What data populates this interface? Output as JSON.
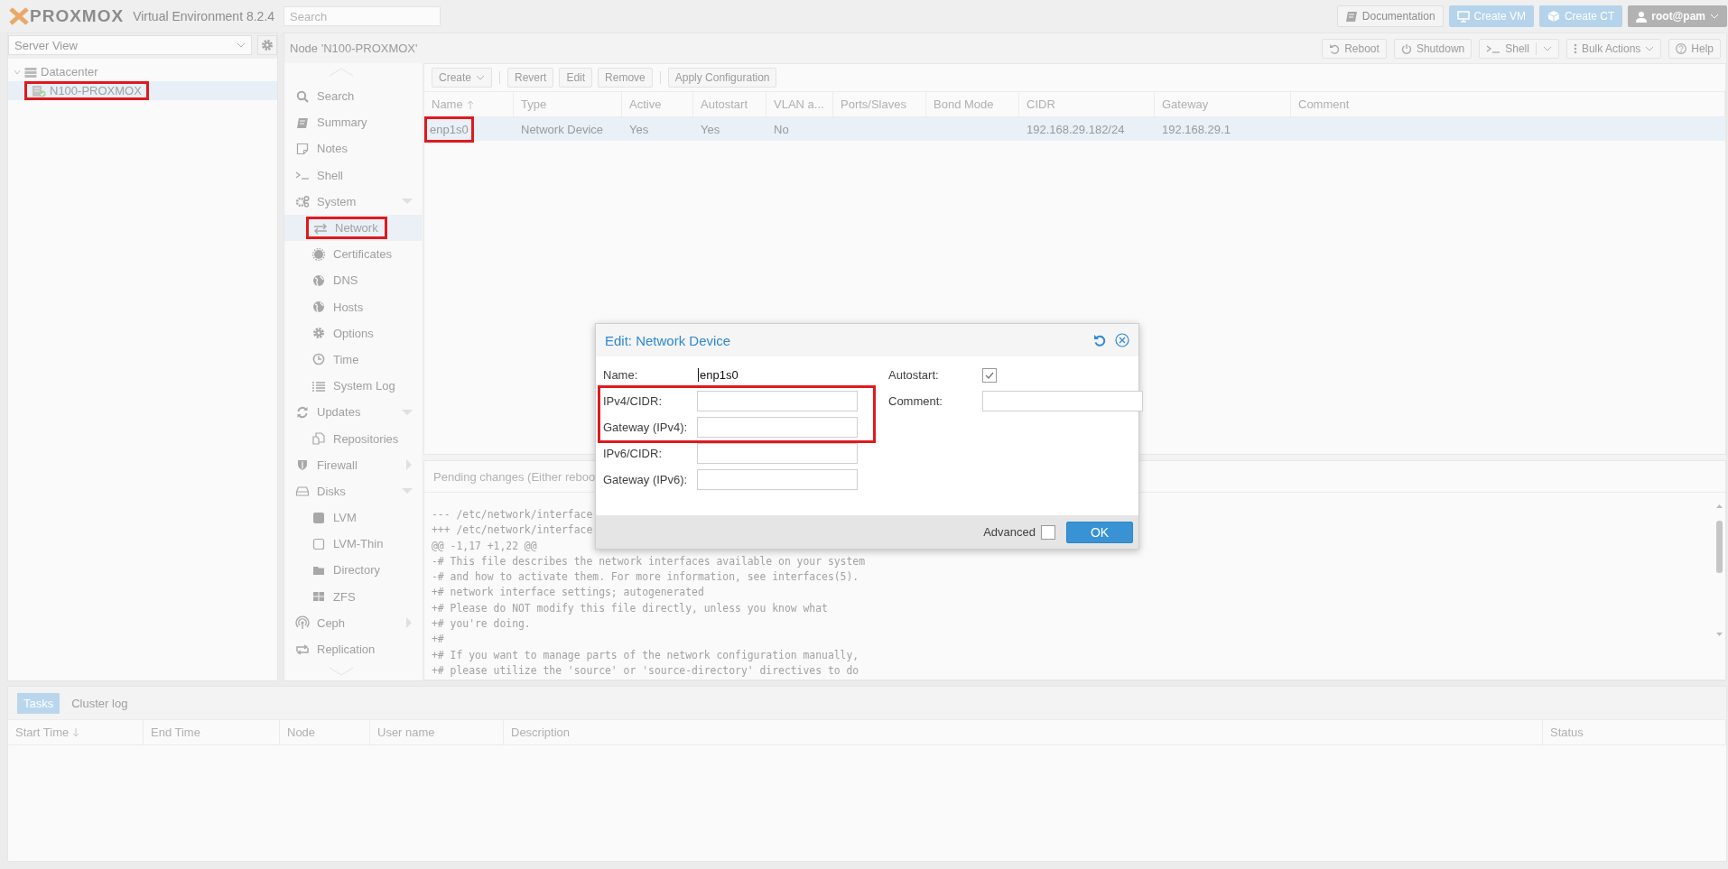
{
  "header": {
    "logo": "PROXMOX",
    "product": "Virtual Environment 8.2.4",
    "search": {
      "placeholder": "Search"
    },
    "buttons": [
      {
        "label": "Documentation",
        "kind": "plain"
      },
      {
        "label": "Create VM",
        "kind": "primary"
      },
      {
        "label": "Create CT",
        "kind": "primary"
      },
      {
        "label": "root@pam",
        "kind": "user"
      }
    ]
  },
  "resource_tree": {
    "view": "Server View",
    "items": [
      {
        "label": "Datacenter",
        "expanded": true,
        "selected": false,
        "highlighted": false,
        "children": [
          {
            "label": "N100-PROXMOX",
            "selected": true,
            "highlighted": true
          }
        ]
      }
    ]
  },
  "node_panel": {
    "title": "Node 'N100-PROXMOX'",
    "buttons": [
      {
        "label": "Reboot",
        "kind": "plain"
      },
      {
        "label": "Shutdown",
        "kind": "plain"
      },
      {
        "label": "Shell",
        "kind": "split"
      },
      {
        "label": "Bulk Actions",
        "kind": "menu"
      },
      {
        "label": "Help",
        "kind": "plain"
      }
    ]
  },
  "nav": [
    {
      "label": "Search",
      "kind": "item",
      "selected": false,
      "highlighted": false
    },
    {
      "label": "Summary",
      "kind": "item",
      "selected": false,
      "highlighted": false
    },
    {
      "label": "Notes",
      "kind": "item",
      "selected": false,
      "highlighted": false
    },
    {
      "label": "Shell",
      "kind": "item",
      "selected": false,
      "highlighted": false
    },
    {
      "label": "System",
      "kind": "group",
      "expanded": true,
      "selected": false,
      "highlighted": false,
      "children": [
        {
          "label": "Network",
          "selected": true,
          "highlighted": true
        },
        {
          "label": "Certificates",
          "selected": false,
          "highlighted": false
        },
        {
          "label": "DNS",
          "selected": false,
          "highlighted": false
        },
        {
          "label": "Hosts",
          "selected": false,
          "highlighted": false
        },
        {
          "label": "Options",
          "selected": false,
          "highlighted": false
        },
        {
          "label": "Time",
          "selected": false,
          "highlighted": false
        },
        {
          "label": "System Log",
          "selected": false,
          "highlighted": false
        }
      ]
    },
    {
      "label": "Updates",
      "kind": "group",
      "expanded": true,
      "selected": false,
      "highlighted": false,
      "children": [
        {
          "label": "Repositories",
          "selected": false,
          "highlighted": false
        }
      ]
    },
    {
      "label": "Firewall",
      "kind": "group",
      "expanded": false,
      "selected": false,
      "highlighted": false
    },
    {
      "label": "Disks",
      "kind": "group",
      "expanded": true,
      "selected": false,
      "highlighted": false,
      "children": [
        {
          "label": "LVM",
          "selected": false,
          "highlighted": false
        },
        {
          "label": "LVM-Thin",
          "selected": false,
          "highlighted": false
        },
        {
          "label": "Directory",
          "selected": false,
          "highlighted": false
        },
        {
          "label": "ZFS",
          "selected": false,
          "highlighted": false
        }
      ]
    },
    {
      "label": "Ceph",
      "kind": "group",
      "expanded": false,
      "selected": false,
      "highlighted": false
    },
    {
      "label": "Replication",
      "kind": "item",
      "selected": false,
      "highlighted": false
    }
  ],
  "network": {
    "toolbar": [
      {
        "label": "Create",
        "kind": "menu"
      },
      {
        "label": "Revert",
        "kind": "plain"
      },
      {
        "label": "Edit",
        "kind": "plain"
      },
      {
        "label": "Remove",
        "kind": "plain"
      },
      {
        "label": "Apply Configuration",
        "kind": "plain"
      }
    ],
    "columns": [
      {
        "label": "Name",
        "sorted": true,
        "descending": false
      },
      {
        "label": "Type",
        "sorted": false
      },
      {
        "label": "Active",
        "sorted": false
      },
      {
        "label": "Autostart",
        "sorted": false
      },
      {
        "label": "VLAN a...",
        "sorted": false
      },
      {
        "label": "Ports/Slaves",
        "sorted": false
      },
      {
        "label": "Bond Mode",
        "sorted": false
      },
      {
        "label": "CIDR",
        "sorted": false
      },
      {
        "label": "Gateway",
        "sorted": false
      },
      {
        "label": "Comment",
        "sorted": false
      }
    ],
    "rows": [
      {
        "selected": true,
        "cells": [
          {
            "text": "enp1s0",
            "highlighted": true
          },
          {
            "text": "Network Device"
          },
          {
            "text": "Yes"
          },
          {
            "text": "Yes"
          },
          {
            "text": "No"
          },
          null,
          null,
          {
            "text": "192.168.29.182/24"
          },
          {
            "text": "192.168.29.1"
          },
          null
        ]
      }
    ],
    "pending": {
      "title": "Pending changes (Either reboo",
      "lines": [
        "--- /etc/network/interface",
        "+++ /etc/network/interface",
        "@@ -1,17 +1,22 @@",
        "-# This file describes the network interfaces available on your system",
        "-# and how to activate them. For more information, see interfaces(5).",
        "+# network interface settings; autogenerated",
        "+# Please do NOT modify this file directly, unless you know what",
        "+# you're doing.",
        "+#",
        "+# If you want to manage parts of the network configuration manually,",
        "+# please utilize the 'source' or 'source-directory' directives to do"
      ]
    }
  },
  "dialog": {
    "title": "Edit: Network Device",
    "left_fields": [
      {
        "label": "Name:",
        "kind": "display",
        "value": "enp1s0",
        "highlighted": false
      },
      {
        "label": "IPv4/CIDR:",
        "kind": "input",
        "highlighted": true
      },
      {
        "label": "Gateway (IPv4):",
        "kind": "input",
        "highlighted": true
      },
      {
        "label": "IPv6/CIDR:",
        "kind": "input",
        "highlighted": false
      },
      {
        "label": "Gateway (IPv6):",
        "kind": "input",
        "highlighted": false
      }
    ],
    "right_fields": [
      {
        "label": "Autostart:",
        "kind": "checkbox",
        "checked": true
      },
      {
        "label": "Comment:",
        "kind": "input"
      }
    ],
    "advanced": {
      "label": "Advanced",
      "checked": false
    },
    "ok": "OK"
  },
  "tasks": {
    "tabs": [
      {
        "label": "Tasks",
        "selected": true
      },
      {
        "label": "Cluster log",
        "selected": false
      }
    ],
    "columns": [
      {
        "label": "Start Time",
        "sorted": true,
        "descending": true
      },
      {
        "label": "End Time",
        "sorted": false
      },
      {
        "label": "Node",
        "sorted": false
      },
      {
        "label": "User name",
        "sorted": false
      },
      {
        "label": "Description",
        "sorted": false
      },
      {
        "label": "Status",
        "sorted": false
      }
    ]
  }
}
